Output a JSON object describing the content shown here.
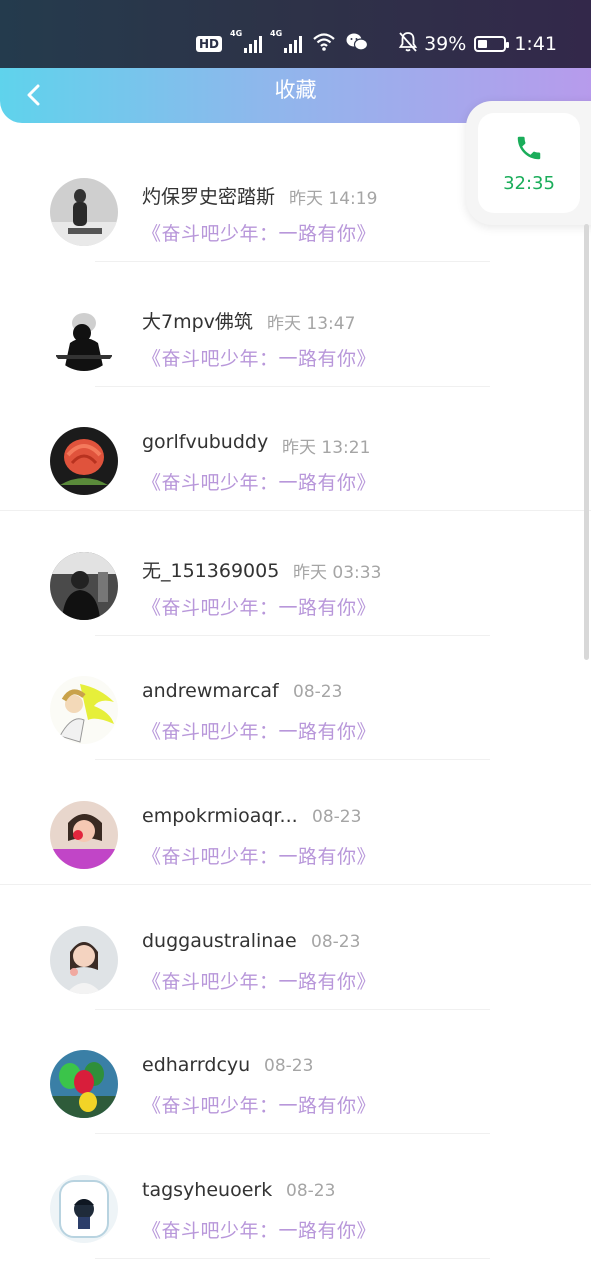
{
  "status_bar": {
    "hd_label": "HD",
    "sim1_label": "4G",
    "sim2_label": "4G",
    "battery_percent": "39%",
    "battery_level": 0.39,
    "clock": "1:41"
  },
  "header": {
    "title": "收藏",
    "back_icon": "chevron-left-icon"
  },
  "call": {
    "icon": "phone-icon",
    "duration": "32:35",
    "color": "#1aad5a"
  },
  "colors": {
    "header_start": "#5fd3ec",
    "header_end": "#b79bec",
    "favorite_title": "#b897da"
  },
  "favorites": [
    {
      "name": "灼保罗史密踏斯",
      "time": "昨天 14:19",
      "title": "《奋斗吧少年：一路有你》"
    },
    {
      "name": "大7mpv佛筑",
      "time": "昨天 13:47",
      "title": "《奋斗吧少年：一路有你》"
    },
    {
      "name": "gorlfvubuddy",
      "time": "昨天 13:21",
      "title": "《奋斗吧少年：一路有你》"
    },
    {
      "name": "无_151369005",
      "time": "昨天 03:33",
      "title": "《奋斗吧少年：一路有你》"
    },
    {
      "name": "andrewmarcaf",
      "time": "08-23",
      "title": "《奋斗吧少年：一路有你》"
    },
    {
      "name": "empokrmioaqr...",
      "time": "08-23",
      "title": "《奋斗吧少年：一路有你》"
    },
    {
      "name": "duggaustralinae",
      "time": "08-23",
      "title": "《奋斗吧少年：一路有你》"
    },
    {
      "name": "edharrdcyu",
      "time": "08-23",
      "title": "《奋斗吧少年：一路有你》"
    },
    {
      "name": "tagsyheuoerk",
      "time": "08-23",
      "title": "《奋斗吧少年：一路有你》"
    }
  ]
}
